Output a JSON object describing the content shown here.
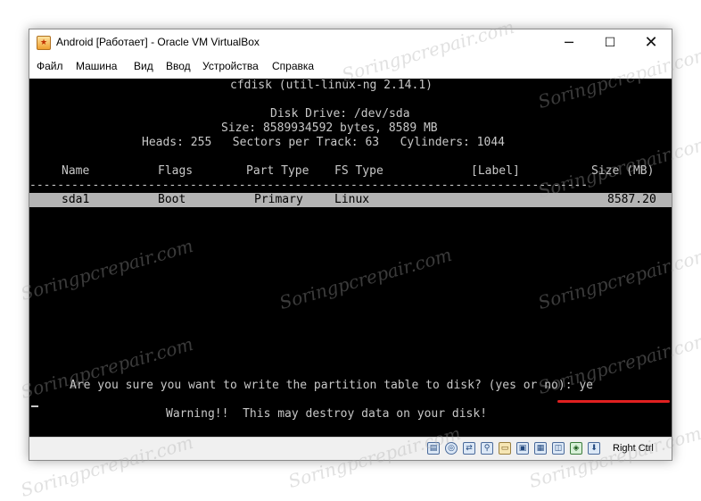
{
  "window": {
    "title": "Android [Работает] - Oracle VM VirtualBox",
    "controls": {
      "minimize": "─",
      "maximize": "☐",
      "close": "✕"
    }
  },
  "menu": {
    "items": [
      "Файл",
      "Машина",
      "Вид",
      "Ввод",
      "Устройства",
      "Справка"
    ]
  },
  "terminal": {
    "header": "cfdisk (util-linux-ng 2.14.1)",
    "disk_drive": "Disk Drive: /dev/sda",
    "size_line": "Size: 8589934592 bytes, 8589 MB",
    "geometry_line": "Heads: 255   Sectors per Track: 63   Cylinders: 1044",
    "columns": [
      "Name",
      "Flags",
      "Part Type",
      "FS Type",
      "[Label]",
      "Size (MB)"
    ],
    "separator": "--------------------------------------------------------------------------------",
    "rows": [
      {
        "name": "sda1",
        "flags": "Boot",
        "part_type": "Primary",
        "fs_type": "Linux",
        "label": "",
        "size": "8587.20"
      }
    ],
    "prompt": "Are you sure you want to write the partition table to disk? (yes or no): ye",
    "warning": "Warning!!  This may destroy data on your disk!"
  },
  "statusbar": {
    "icons": [
      "hard-disk",
      "optical-drive",
      "network",
      "usb",
      "shared-folders",
      "display",
      "video-capture",
      "capture",
      "mouse-integration",
      "keyboard-capture"
    ],
    "host_key": "Right Ctrl"
  },
  "watermark": "Soringpcrepair.com"
}
